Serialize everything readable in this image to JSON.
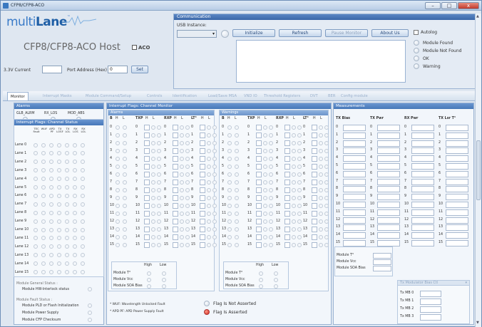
{
  "window": {
    "title": "CFP8/CFP8-ACO",
    "min": "–",
    "max": "□",
    "close": "x"
  },
  "logo": {
    "multi": "multi",
    "lane": "Lane",
    "tm": "™"
  },
  "header": {
    "title": "CFP8/CFP8-ACO Host",
    "aco_label": "ACO",
    "current_label": "3.3V Current",
    "port_label": "Port Address (Hex)",
    "port_value": "0",
    "set": "Set"
  },
  "comm": {
    "title": "Communication",
    "usb_label": "USB Instance:",
    "usb_value": "",
    "initialize": "Initialize",
    "refresh": "Refresh",
    "pause": "Pause Monitor",
    "about": "About Us",
    "autolog": "Autolog",
    "status": [
      "Module Found",
      "Module Not Found",
      "OK",
      "Warning"
    ]
  },
  "tabs": [
    "Monitor",
    "Interrupt Masks",
    "Module Command/Setup",
    "Controls",
    "Identification",
    "Load/Save MSA",
    "VND IO",
    "Threshold Registers",
    "DVT",
    "BER",
    "Config module"
  ],
  "alarms": {
    "title": "Alarms",
    "items": [
      "GLB_ALRM",
      "RX_LOS",
      "MOD_ABS"
    ]
  },
  "irq": {
    "title": "Interrupt Flags: Channel Status",
    "cols": [
      "TEC Fault",
      "WUF",
      "APD PF",
      "TX LOSF",
      "TX LOL",
      "RX LOS",
      "RX LOL"
    ],
    "lanes": [
      "Lane 0",
      "Lane 1",
      "Lane 2",
      "Lane 3",
      "Lane 4",
      "Lane 5",
      "Lane 6",
      "Lane 7",
      "Lane 8",
      "Lane 9",
      "Lane 10",
      "Lane 11",
      "Lane 12",
      "Lane 13",
      "Lane 14",
      "Lane 15"
    ]
  },
  "general": {
    "title": "Module General Status :",
    "item": "Module HW-Interlock status"
  },
  "fault": {
    "title": "Module Fault Status :",
    "items": [
      "Module PLD or Flash Initialization",
      "Module Power Supply",
      "Module CFP Checksum"
    ]
  },
  "monitor": {
    "title": "Interrupt Flags: Channel Monitor",
    "alarms": "Alarms",
    "warnings": "Warnings",
    "groups": [
      {
        "name": "B",
        "hl": [
          "H",
          "L"
        ]
      },
      {
        "name": "TXP",
        "hl": [
          "H",
          "L"
        ]
      },
      {
        "name": "RXP",
        "hl": [
          "H",
          "L"
        ]
      },
      {
        "name": "LT°",
        "hl": [
          "H",
          "L"
        ]
      }
    ],
    "rows": [
      "0",
      "1",
      "2",
      "3",
      "4",
      "5",
      "6",
      "7",
      "8",
      "9",
      "10",
      "11",
      "12",
      "13",
      "14",
      "15"
    ],
    "high": "High",
    "low": "Low",
    "mod_items": [
      "Module T°",
      "Module Vcc",
      "Module SOA Bias"
    ]
  },
  "notes": {
    "wuf": "* WUF: Wavelength Unlocked Fault",
    "apd": "* APD PF: APD Power Supply Fault",
    "not_asserted": "Flag Is Not Asserted",
    "asserted": "Flag Is Asserted"
  },
  "meas": {
    "title": "Measurements",
    "cols": [
      "TX Bias",
      "TX Pwr",
      "RX Pwr",
      "TX Lsr T°"
    ],
    "rows": [
      "0",
      "1",
      "2",
      "3",
      "4",
      "5",
      "6",
      "7",
      "8",
      "9",
      "10",
      "11",
      "12",
      "13",
      "14",
      "15"
    ],
    "mod_items": [
      "Module T°",
      "Module Vcc",
      "Module SOA Bias"
    ],
    "mb_title": "Tx Modulator Bias Ctl",
    "mb_items": [
      "Tx MB 0",
      "Tx MB 1",
      "Tx MB 2",
      "Tx MB 3"
    ]
  },
  "colors": {
    "accent": "#3b67a8",
    "asserted": "#d2281a"
  }
}
